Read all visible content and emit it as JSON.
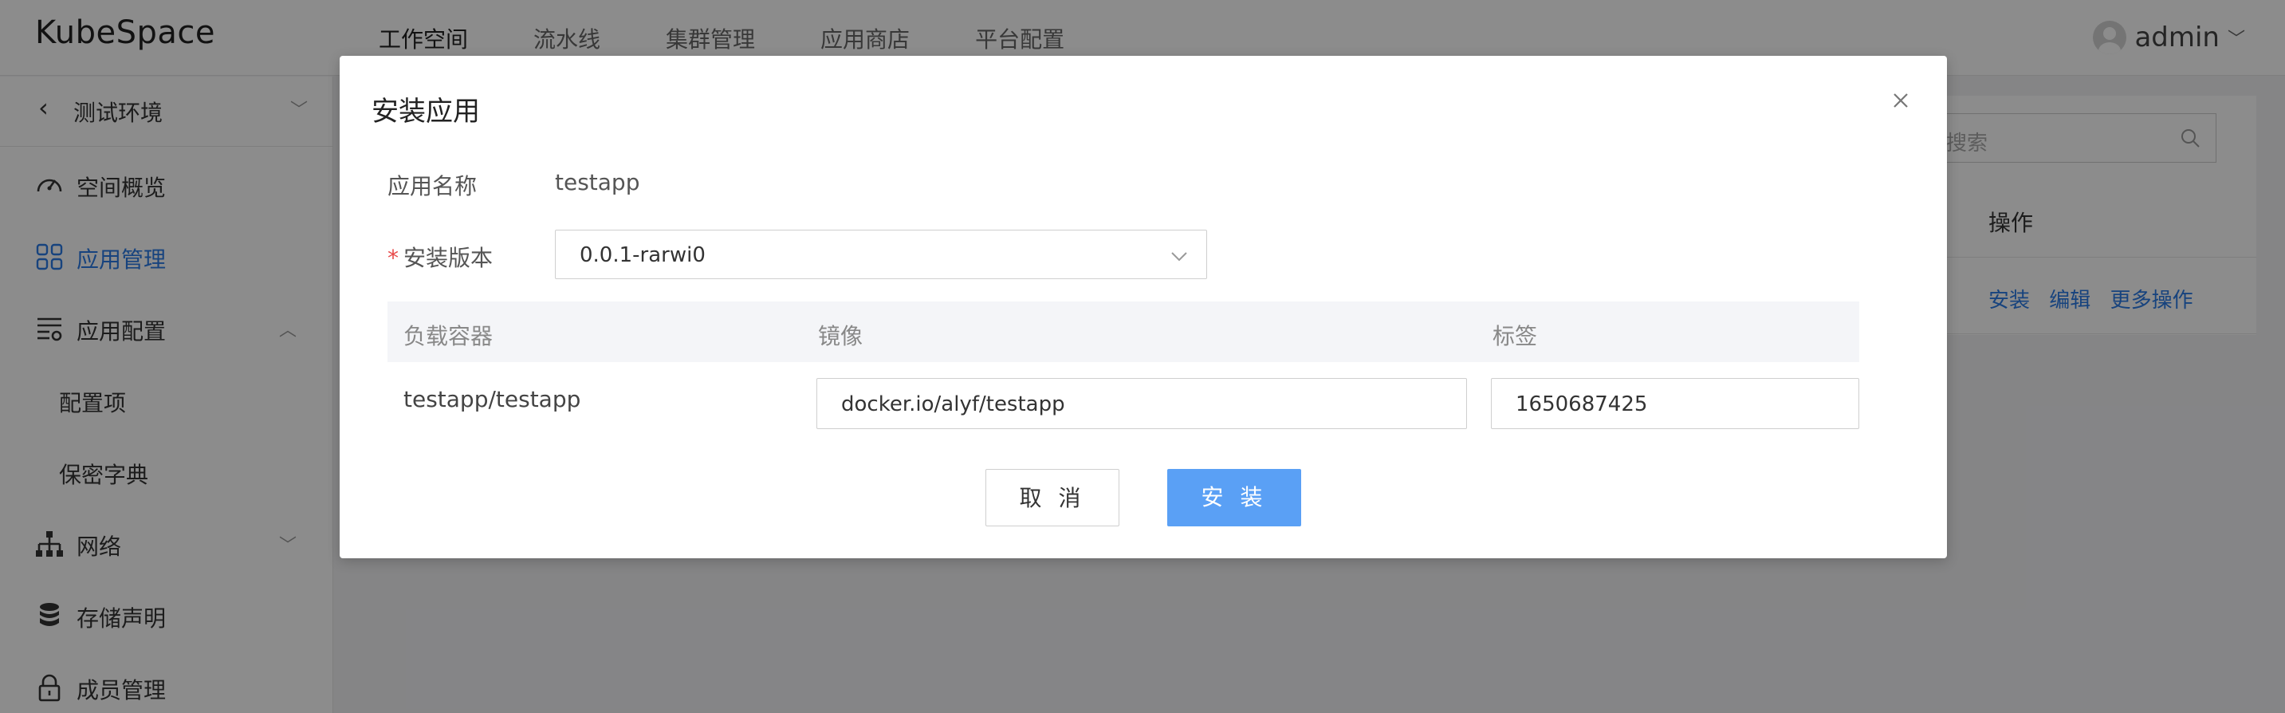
{
  "app": {
    "logo": "KubeSpace"
  },
  "header": {
    "nav": [
      "工作空间",
      "流水线",
      "集群管理",
      "应用商店",
      "平台配置"
    ],
    "user": "admin"
  },
  "sidebar": {
    "env": "测试环境",
    "items": [
      {
        "label": "空间概览",
        "icon": "dashboard-icon"
      },
      {
        "label": "应用管理",
        "icon": "apps-grid-icon"
      },
      {
        "label": "应用配置",
        "icon": "config-list-icon"
      },
      {
        "label": "配置项"
      },
      {
        "label": "保密字典"
      },
      {
        "label": "网络",
        "icon": "network-icon"
      },
      {
        "label": "存储声明",
        "icon": "database-icon"
      },
      {
        "label": "成员管理",
        "icon": "lock-icon"
      }
    ]
  },
  "background": {
    "search_placeholder": "搜索",
    "column_op": "操作",
    "row_ops": [
      "安装",
      "编辑",
      "更多操作"
    ]
  },
  "modal": {
    "title": "安装应用",
    "app_name_label": "应用名称",
    "app_name_value": "testapp",
    "required_mark": "*",
    "version_label": "安装版本",
    "version_value": "0.0.1-rarwi0",
    "table": {
      "headers": [
        "负载容器",
        "镜像",
        "标签"
      ],
      "rows": [
        {
          "container": "testapp/testapp",
          "image": "docker.io/alyf/testapp",
          "tag": "1650687425"
        }
      ]
    },
    "cancel_label": "取 消",
    "install_label": "安 装"
  },
  "colors": {
    "primary": "#2b7be5",
    "install_button": "#5aa0f5",
    "required": "#e84a4a"
  }
}
